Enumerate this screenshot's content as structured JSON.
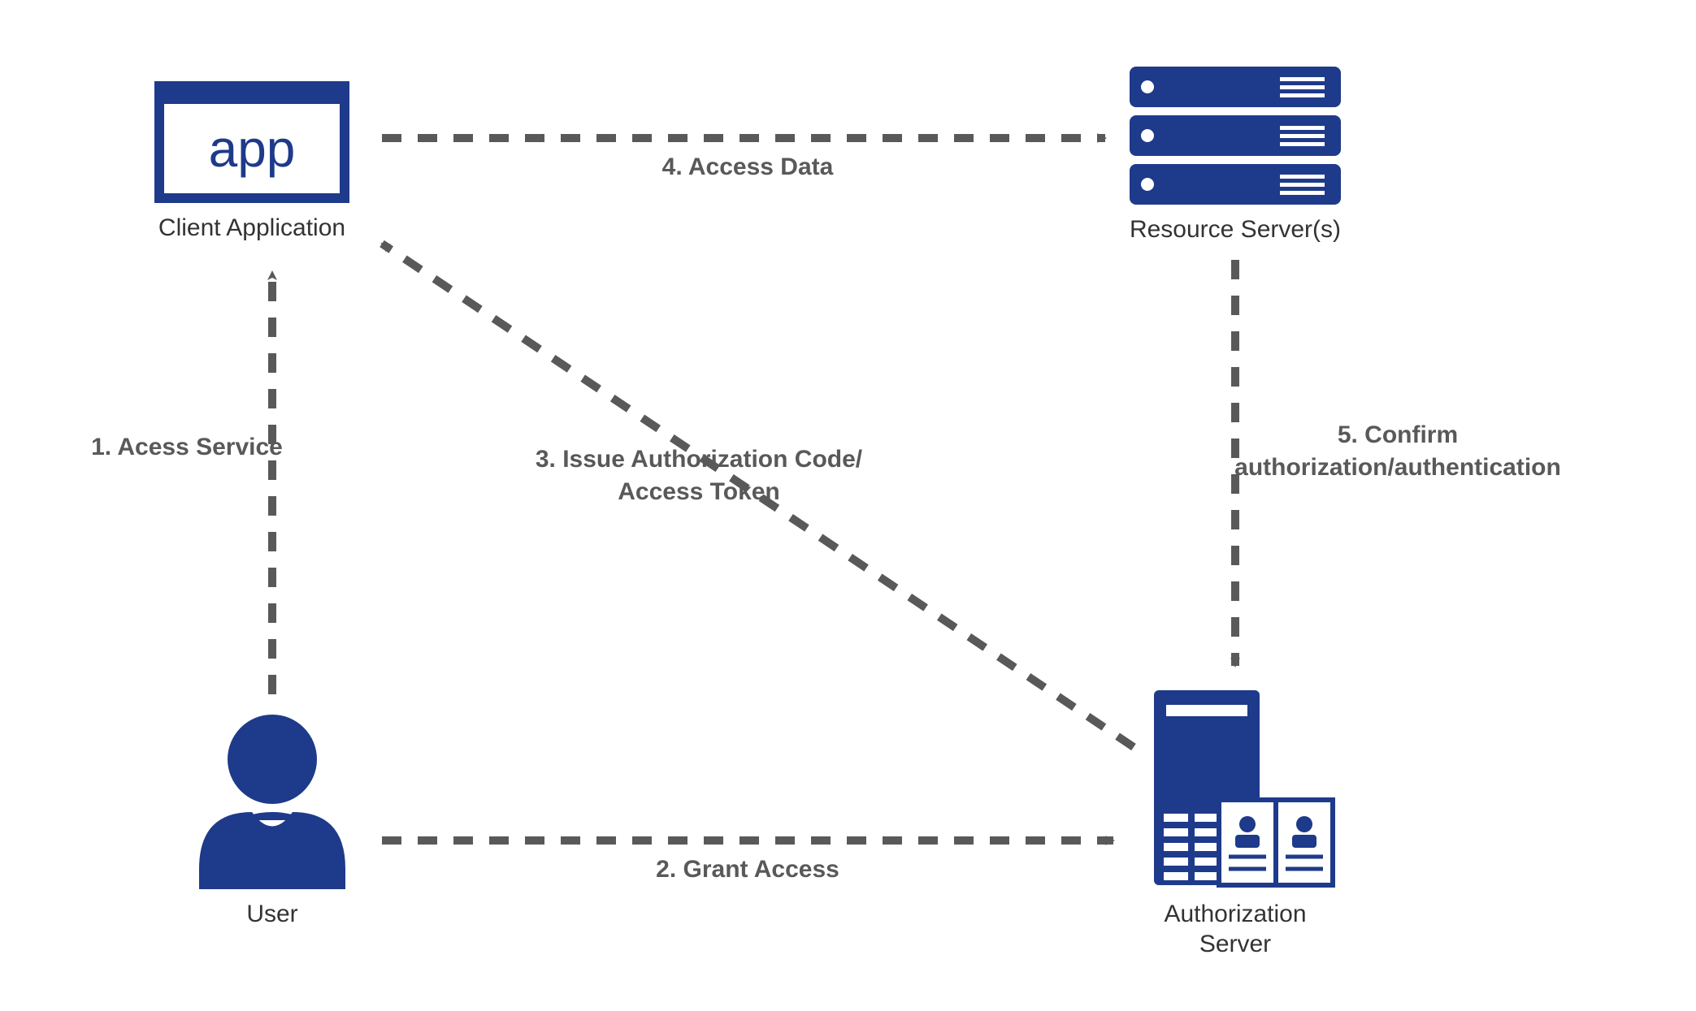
{
  "nodes": {
    "client": {
      "label": "Client Application",
      "icon_text": "app"
    },
    "resource": {
      "label": "Resource Server(s)"
    },
    "user": {
      "label": "User"
    },
    "auth": {
      "label_line1": "Authorization",
      "label_line2": "Server"
    }
  },
  "edges": {
    "e1": {
      "label": "1. Acess Service"
    },
    "e2": {
      "label": "2. Grant Access"
    },
    "e3": {
      "line1": "3. Issue Authorization Code/",
      "line2": "Access Token"
    },
    "e4": {
      "label": "4. Access Data"
    },
    "e5": {
      "line1": "5. Confirm",
      "line2": "authorization/authentication"
    }
  },
  "colors": {
    "brand": "#1e3a8a",
    "arrow": "#595959",
    "text": "#333333"
  }
}
